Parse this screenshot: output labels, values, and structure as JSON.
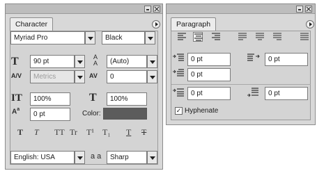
{
  "character": {
    "tab_label": "Character",
    "font_family": "Myriad Pro",
    "font_style": "Black",
    "font_size": "90 pt",
    "leading": "(Auto)",
    "kerning": "Metrics",
    "tracking": "0",
    "vertical_scale": "100%",
    "horizontal_scale": "100%",
    "baseline_shift": "0 pt",
    "color_label": "Color:",
    "color_swatch": "#5c5c5c",
    "language": "English: USA",
    "antialias_glyph": "a a",
    "antialias": "Sharp",
    "style_buttons": [
      "T",
      "T",
      "TT",
      "Tr",
      "T¹",
      "T₁",
      "T",
      "T"
    ]
  },
  "paragraph": {
    "tab_label": "Paragraph",
    "indent_left": "0 pt",
    "indent_right": "0 pt",
    "indent_first": "0 pt",
    "space_before": "0 pt",
    "space_after": "0 pt",
    "hyphenate_label": "Hyphenate",
    "hyphenate_checked": "✓"
  }
}
